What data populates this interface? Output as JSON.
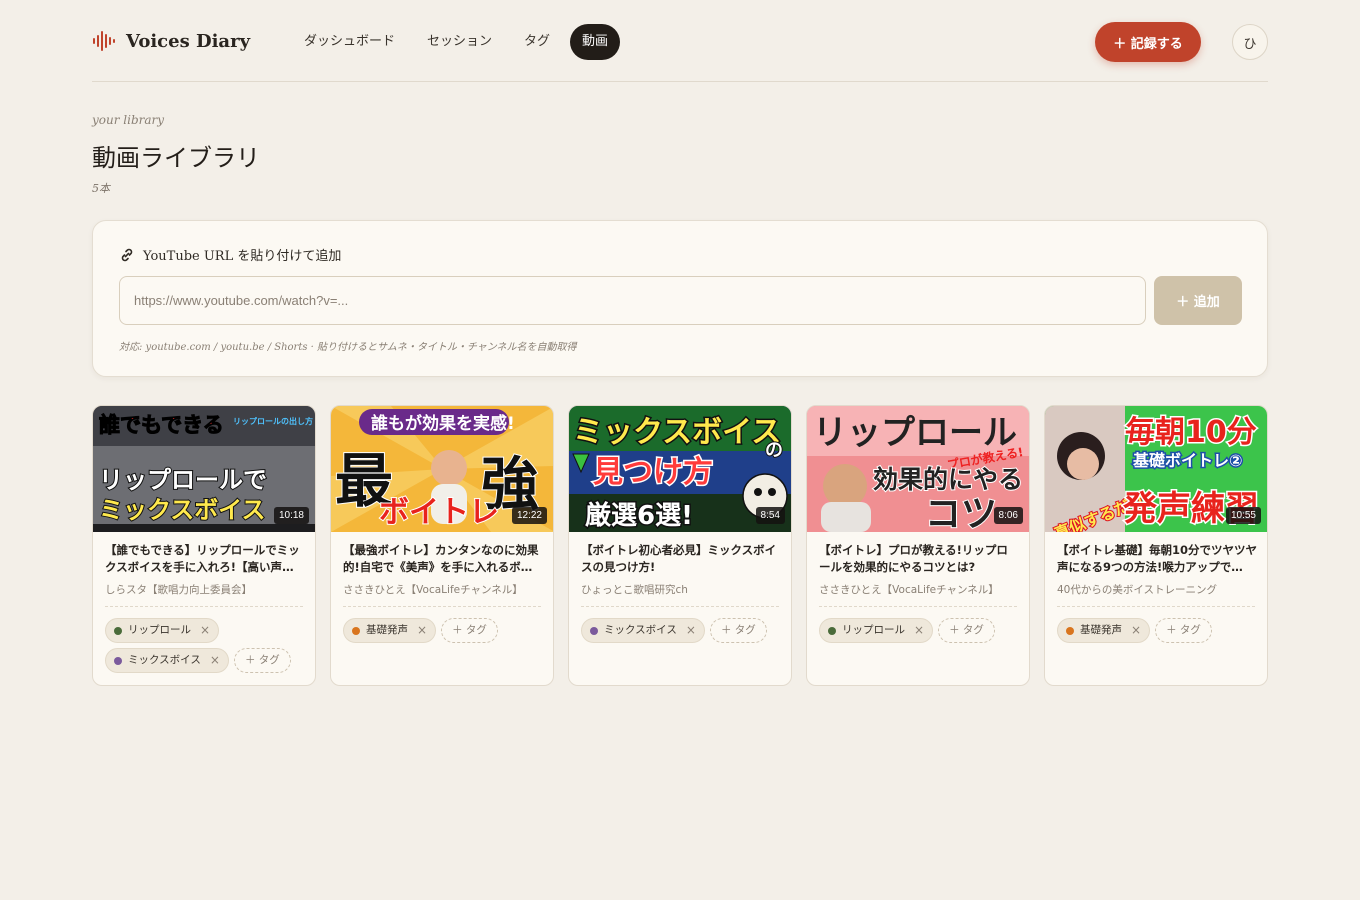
{
  "header": {
    "app_name": "Voices Diary",
    "nav": [
      {
        "label": "ダッシュボード",
        "active": false
      },
      {
        "label": "セッション",
        "active": false
      },
      {
        "label": "タグ",
        "active": false
      },
      {
        "label": "動画",
        "active": true
      }
    ],
    "record_label": "＋ 記録する",
    "avatar_initial": "ひ"
  },
  "page": {
    "eyebrow": "your library",
    "title": "動画ライブラリ",
    "count": "5本"
  },
  "add_video": {
    "label": "YouTube URL を貼り付けて追加",
    "placeholder": "https://www.youtube.com/watch?v=...",
    "button": "＋ 追加",
    "hint": "対応: youtube.com / youtu.be / Shorts · 貼り付けるとサムネ・タイトル・チャンネル名を自動取得"
  },
  "videos": [
    {
      "title": "【誰でもできる】リップロールでミックスボイスを手に入れろ!【高い声が…",
      "channel": "しらスタ【歌唱力向上委員会】",
      "duration": "10:18",
      "thumb_text": [
        "誰でもできる",
        "リップロールの出し方",
        "リップロールで",
        "ミックスボイス"
      ],
      "tags": [
        {
          "label": "リップロール",
          "color": "#4a6b3a"
        },
        {
          "label": "ミックスボイス",
          "color": "#7b5a9c"
        }
      ],
      "tag_add": "＋ タグ"
    },
    {
      "title": "【最強ボイトレ】カンタンなのに効果的!自宅で《美声》を手に入れるボ…",
      "channel": "ささきひとえ【VocaLifeチャンネル】",
      "duration": "12:22",
      "thumb_text": [
        "誰もが効果を実感!",
        "最",
        "強",
        "ボイトレ"
      ],
      "tags": [
        {
          "label": "基礎発声",
          "color": "#d9751e"
        }
      ],
      "tag_add": "＋ タグ"
    },
    {
      "title": "【ボイトレ初心者必見】ミックスボイスの見つけ方!",
      "channel": "ひょっとこ歌唱研究ch",
      "duration": "8:54",
      "thumb_text": [
        "ミックスボイス",
        "の",
        "見つけ方",
        "厳選6選!"
      ],
      "tags": [
        {
          "label": "ミックスボイス",
          "color": "#7b5a9c"
        }
      ],
      "tag_add": "＋ タグ"
    },
    {
      "title": "【ボイトレ】プロが教える!リップロールを効果的にやるコツとは?",
      "channel": "ささきひとえ【VocaLifeチャンネル】",
      "duration": "8:06",
      "thumb_text": [
        "リップロール",
        "プロが教える!",
        "効果的にやる",
        "コツ"
      ],
      "tags": [
        {
          "label": "リップロール",
          "color": "#4a6b3a"
        }
      ],
      "tag_add": "＋ タグ"
    },
    {
      "title": "【ボイトレ基礎】毎朝10分でツヤツヤ声になる9つの方法!喉力アップで…",
      "channel": "40代からの美ボイストレーニング",
      "duration": "10:55",
      "thumb_text": [
        "毎朝10分",
        "基礎ボイトレ②",
        "真似するだけ",
        "発声練習"
      ],
      "tags": [
        {
          "label": "基礎発声",
          "color": "#d9751e"
        }
      ],
      "tag_add": "＋ タグ"
    }
  ],
  "colors": {
    "accent": "#c0432b",
    "background": "#f3efe8",
    "card": "#fcf9f3",
    "nav_active": "#221d18"
  }
}
